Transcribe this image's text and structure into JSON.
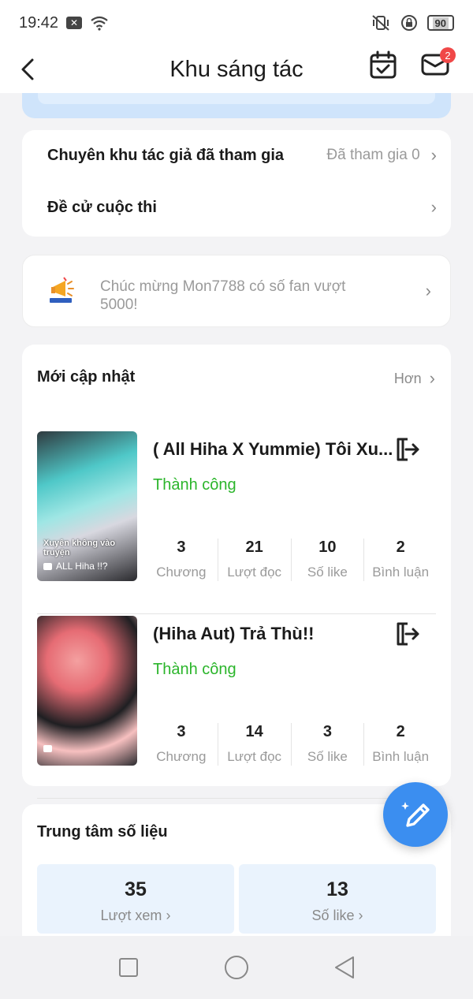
{
  "status_bar": {
    "time": "19:42",
    "battery": "90"
  },
  "header": {
    "title": "Khu sáng tác",
    "mail_badge": "2"
  },
  "links": [
    {
      "label": "Chuyên khu tác giả đã tham gia",
      "value": "Đã tham gia 0"
    },
    {
      "label": "Đề cử cuộc thi",
      "value": ""
    }
  ],
  "notice": {
    "text": "Chúc mừng Mon7788 có số fan vượt 5000!"
  },
  "updates": {
    "title": "Mới cập nhật",
    "more": "Hơn",
    "items": [
      {
        "title": "( All Hiha X Yummie) Tôi Xu...",
        "status": "Thành công",
        "cover_title": "Xuyên không vào truyện",
        "cover_tag": "ALL Hiha !!?",
        "stats": [
          {
            "num": "3",
            "label": "Chương"
          },
          {
            "num": "21",
            "label": "Lượt đọc"
          },
          {
            "num": "10",
            "label": "Số like"
          },
          {
            "num": "2",
            "label": "Bình luận"
          }
        ]
      },
      {
        "title": "(Hiha Aut) Trả Thù!!",
        "status": "Thành công",
        "cover_title": "",
        "cover_tag": "",
        "stats": [
          {
            "num": "3",
            "label": "Chương"
          },
          {
            "num": "14",
            "label": "Lượt đọc"
          },
          {
            "num": "3",
            "label": "Số like"
          },
          {
            "num": "2",
            "label": "Bình luận"
          }
        ]
      }
    ]
  },
  "data_center": {
    "title": "Trung tâm số liệu",
    "boxes": [
      {
        "num": "35",
        "label": "Lượt xem"
      },
      {
        "num": "13",
        "label": "Số like"
      }
    ]
  },
  "colors": {
    "accent": "#3b8ef0",
    "success": "#2bb52b",
    "badge": "#f04848"
  }
}
